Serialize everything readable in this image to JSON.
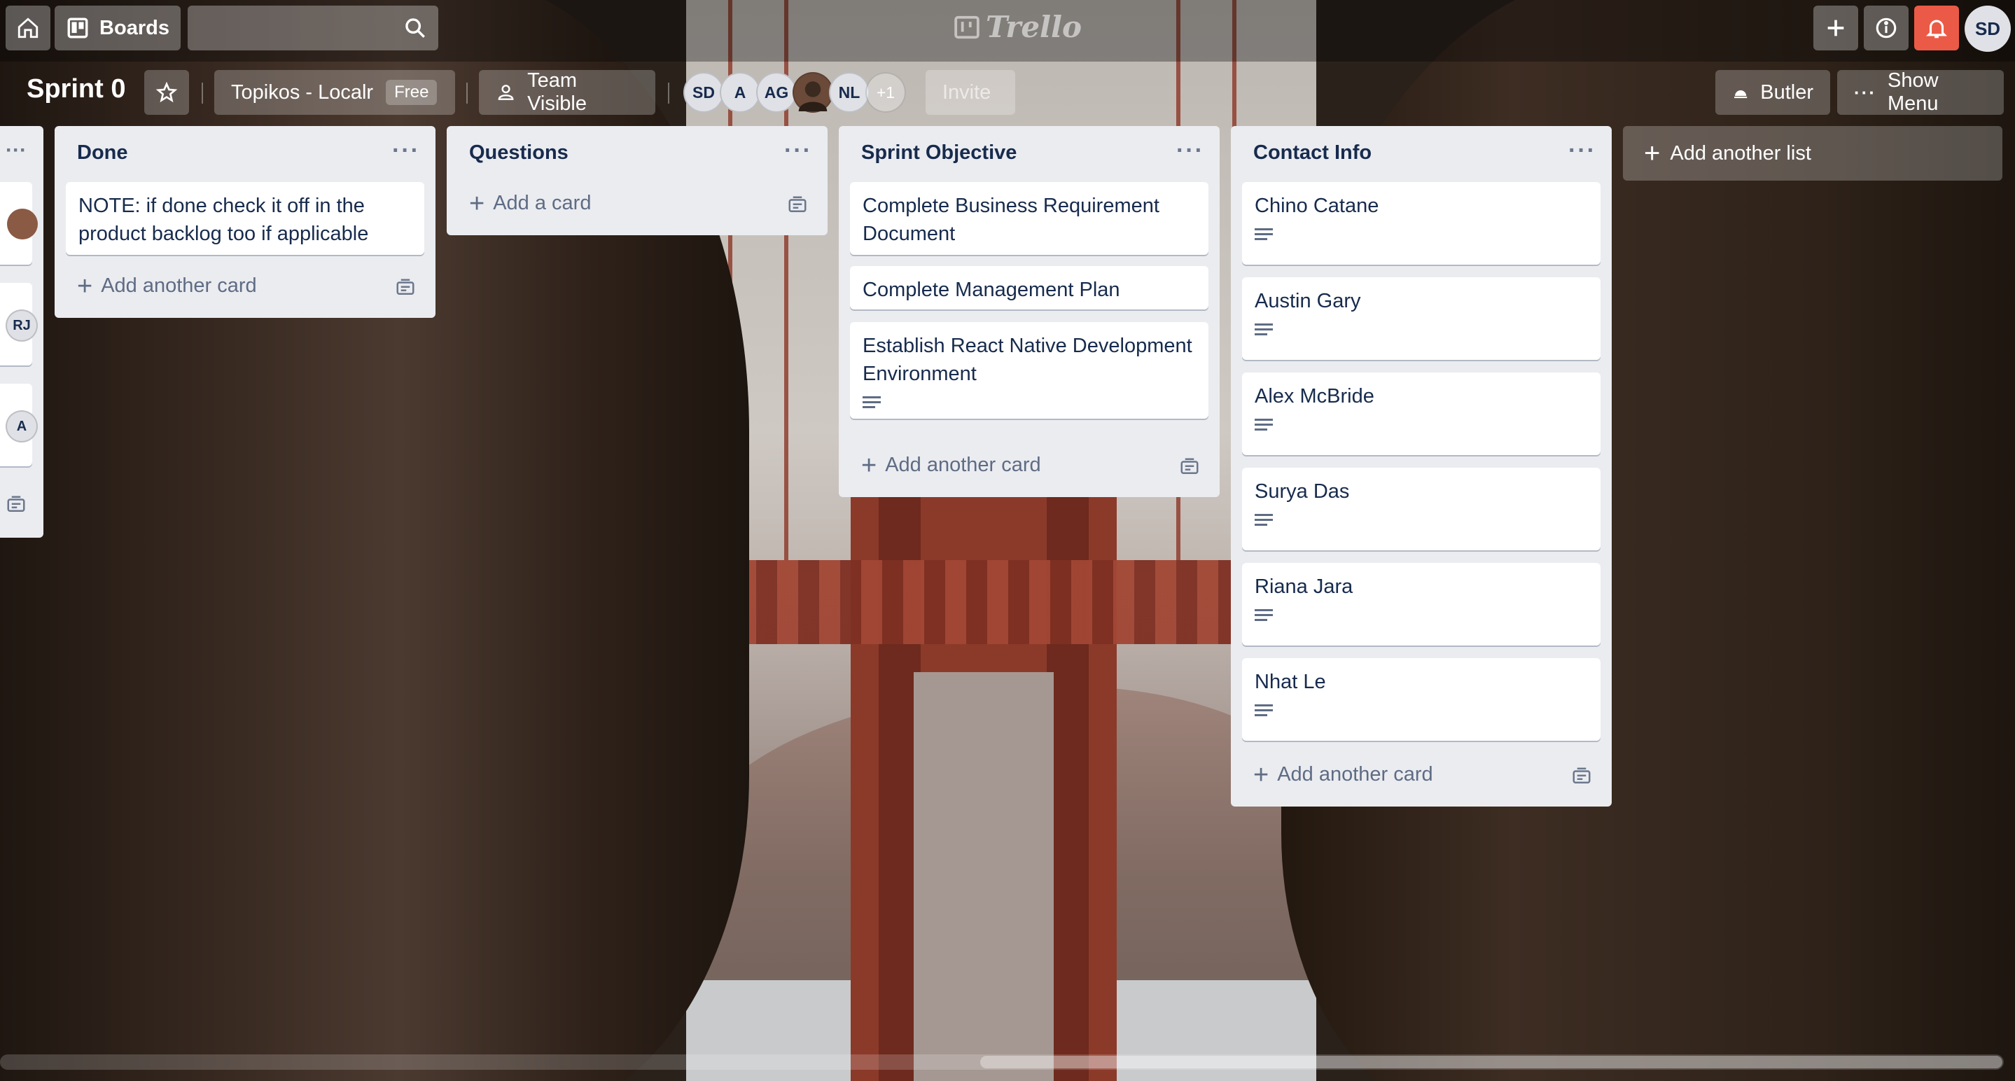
{
  "header": {
    "boards_label": "Boards",
    "logo_text": "Trello",
    "user_initials": "SD"
  },
  "board": {
    "title": "Sprint 0",
    "team_name": "Topikos - Localr",
    "team_badge": "Free",
    "visibility": "Team Visible",
    "members": [
      "SD",
      "A",
      "AG",
      "NL"
    ],
    "member_extra": "+1",
    "invite_label": "Invite",
    "butler_label": "Butler",
    "show_menu_label": "Show Menu"
  },
  "partial_list": {
    "avatars": [
      "RJ",
      "A"
    ]
  },
  "lists": [
    {
      "title": "Done",
      "cards": [
        {
          "text": "NOTE: if done check it off in the product backlog too if applicable"
        }
      ],
      "add_label": "Add another card"
    },
    {
      "title": "Questions",
      "cards": [],
      "add_label": "Add a card"
    },
    {
      "title": "Sprint Objective",
      "cards": [
        {
          "text": "Complete Business Requirement Document"
        },
        {
          "text": "Complete Management Plan"
        },
        {
          "text": "Establish React Native Development Environment",
          "has_description": true
        }
      ],
      "add_label": "Add another card"
    },
    {
      "title": "Contact Info",
      "cards": [
        {
          "text": "Chino Catane",
          "has_description": true
        },
        {
          "text": "Austin Gary",
          "has_description": true
        },
        {
          "text": "Alex McBride",
          "has_description": true
        },
        {
          "text": "Surya Das",
          "has_description": true
        },
        {
          "text": "Riana Jara",
          "has_description": true
        },
        {
          "text": "Nhat Le",
          "has_description": true
        }
      ],
      "add_label": "Add another card"
    }
  ],
  "add_list_label": "Add another list",
  "icons": {
    "home": "home-icon",
    "boards": "board-icon",
    "search": "search-icon",
    "create": "plus-icon",
    "info": "info-icon",
    "notifications": "bell-icon",
    "star": "star-icon",
    "team": "team-icon",
    "butler": "butler-icon",
    "menu": "ellipsis-icon",
    "description": "description-icon",
    "template": "card-template-icon"
  },
  "colors": {
    "notification_bg": "#eb5a46",
    "list_bg": "#ebecf0",
    "card_bg": "#ffffff",
    "text_primary": "#172b4d",
    "text_muted": "#5e6c84"
  }
}
